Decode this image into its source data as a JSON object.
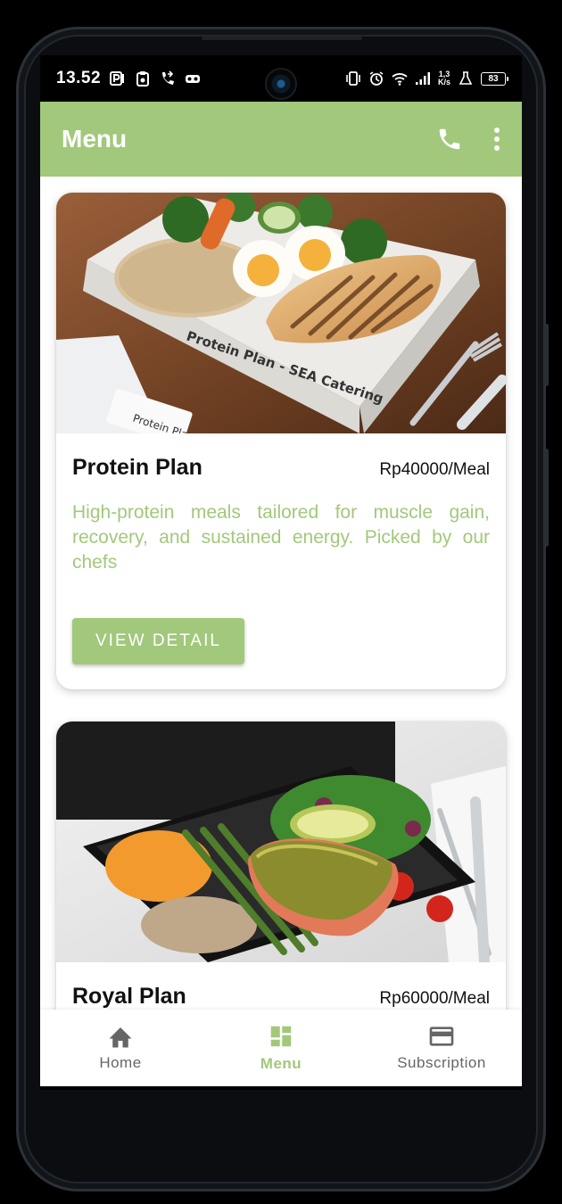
{
  "status_bar": {
    "time": "13.52",
    "net_speed_top": "1,3",
    "net_speed_bottom": "K/s",
    "battery": "83"
  },
  "app_bar": {
    "title": "Menu",
    "icons": [
      "phone-icon",
      "more-vert-icon"
    ]
  },
  "cards": [
    {
      "title": "Protein Plan",
      "price": "Rp40000/Meal",
      "description": "High-protein meals tailored for muscle gain, recovery, and sustained energy. Picked by our chefs",
      "button_label": "VIEW DETAIL",
      "image_box_label": "Protein Plan - SEA Catering",
      "image_note_label": "Protein Plan"
    },
    {
      "title": "Royal Plan",
      "price": "Rp60000/Meal"
    }
  ],
  "bottom_nav": {
    "items": [
      {
        "label": "Home",
        "icon": "home-icon",
        "active": false
      },
      {
        "label": "Menu",
        "icon": "dashboard-icon",
        "active": true
      },
      {
        "label": "Subscription",
        "icon": "credit-card-icon",
        "active": false
      }
    ]
  },
  "colors": {
    "accent": "#a2c87b",
    "nav_inactive": "#666666"
  }
}
